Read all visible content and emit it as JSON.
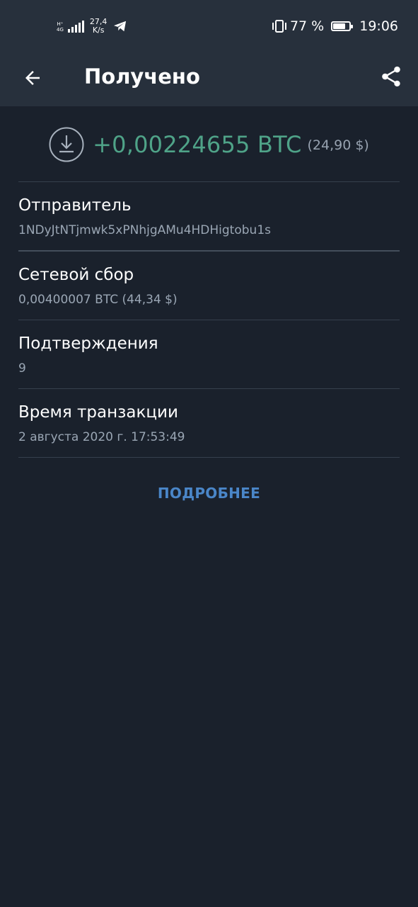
{
  "status_bar": {
    "network_label_top": "H⁺",
    "network_label_bottom": "4G",
    "speed_value": "27,4",
    "speed_unit": "K/s",
    "battery_text": "77 %",
    "battery_level": 0.77,
    "time": "19:06"
  },
  "header": {
    "title": "Получено",
    "back_icon": "arrow-left-icon",
    "share_icon": "share-icon"
  },
  "transaction": {
    "direction_icon": "download-icon",
    "amount": "+0,00224655 BTC",
    "amount_fiat": "(24,90 $)",
    "amount_color": "#4fa388"
  },
  "details": [
    {
      "label": "Отправитель",
      "value": "1NDyJtNTjmwk5xPNhjgAMu4HDHigtobu1s"
    },
    {
      "label": "Сетевой сбор",
      "value": "0,00400007 BTC (44,34 $)"
    },
    {
      "label": "Подтверждения",
      "value": "9"
    },
    {
      "label": "Время транзакции",
      "value": "2 августа 2020 г. 17:53:49"
    }
  ],
  "more_button": {
    "label": "ПОДРОБНЕЕ",
    "color": "#4a86c8"
  }
}
